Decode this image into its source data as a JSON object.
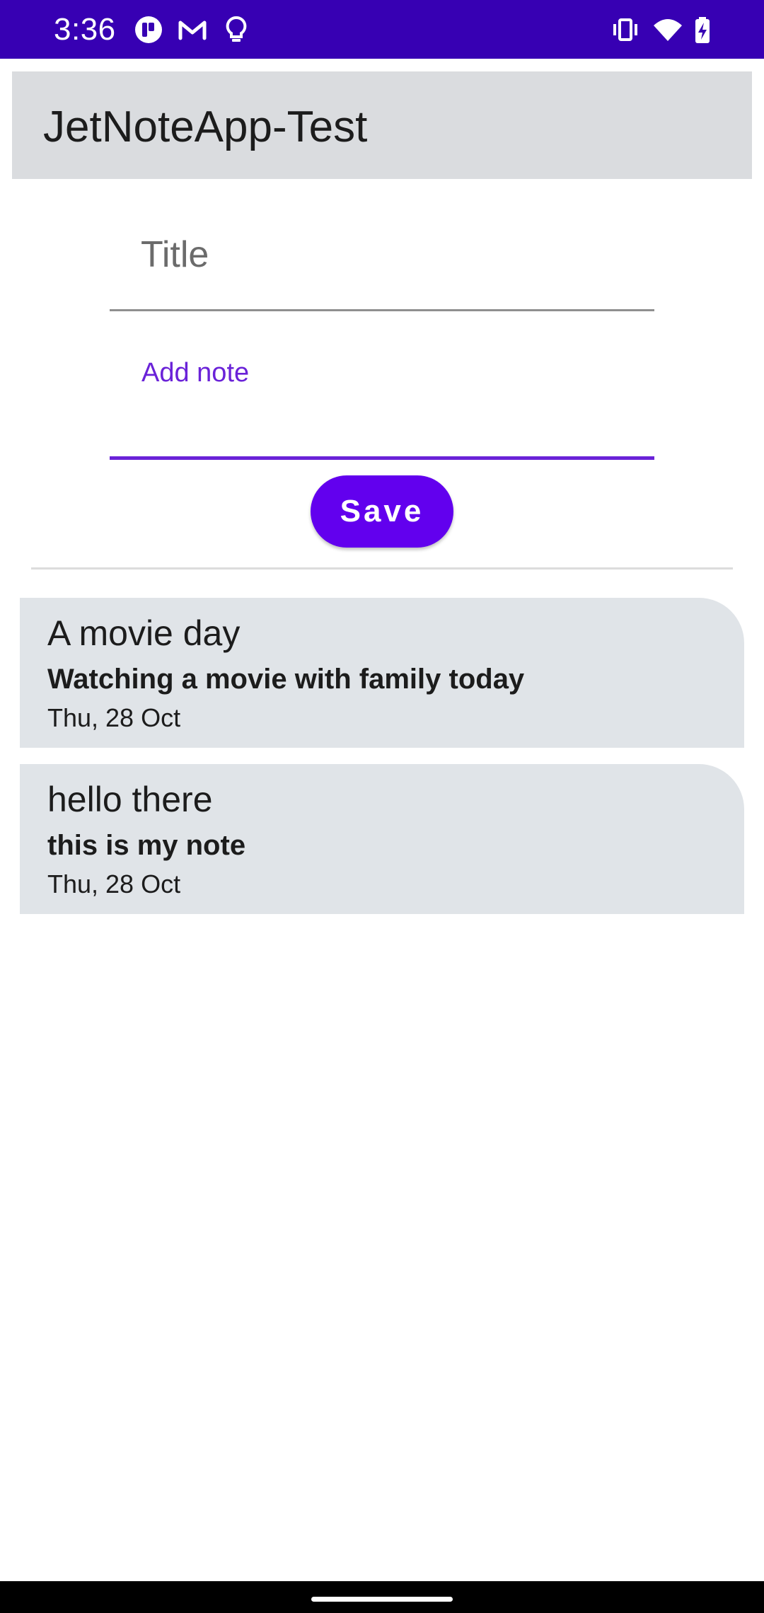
{
  "status_bar": {
    "time": "3:36",
    "background": "#3700b3",
    "left_icons": [
      "app-notification-icon",
      "gmail-icon",
      "lightbulb-icon"
    ],
    "right_icons": [
      "vibrate-icon",
      "wifi-icon",
      "battery-charging-icon"
    ]
  },
  "app_bar": {
    "title": "JetNoteApp-Test",
    "background": "#dadcdf"
  },
  "form": {
    "title_placeholder": "Title",
    "note_label": "Add note",
    "save_label": "Save",
    "accent_color": "#6200ee"
  },
  "notes": [
    {
      "title": "A movie day",
      "body": "Watching a movie with family today",
      "date": "Thu, 28 Oct"
    },
    {
      "title": "hello there",
      "body": "this is my note",
      "date": "Thu, 28 Oct"
    }
  ]
}
